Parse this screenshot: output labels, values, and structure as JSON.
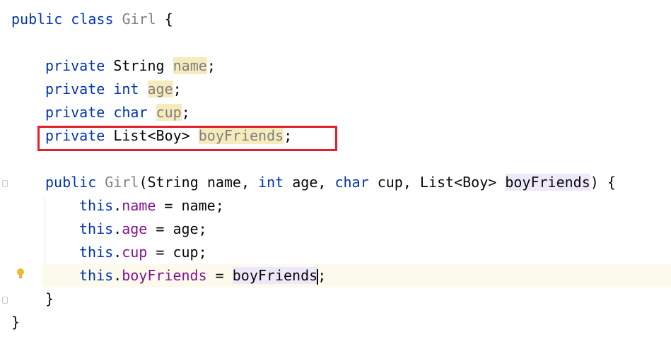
{
  "editor": {
    "lines": [
      {
        "id": "l1",
        "text": "public class Girl {"
      },
      {
        "id": "l3",
        "text": "private String name;"
      },
      {
        "id": "l4",
        "text": "private int age;"
      },
      {
        "id": "l5",
        "text": "private char cup;"
      },
      {
        "id": "l6",
        "text": "private List<Boy> boyFriends;"
      },
      {
        "id": "l8",
        "text": "public Girl(String name, int age, char cup, List<Boy> boyFriends) {"
      },
      {
        "id": "l9",
        "text": "this.name = name;"
      },
      {
        "id": "l10",
        "text": "this.age = age;"
      },
      {
        "id": "l11",
        "text": "this.cup = cup;"
      },
      {
        "id": "l12",
        "text": "this.boyFriends = boyFriends;"
      },
      {
        "id": "l13",
        "text": "}"
      },
      {
        "id": "l14",
        "text": "}"
      }
    ],
    "tokens": {
      "public": "public",
      "class": "class",
      "girl": "Girl",
      "open_brace": "{",
      "close_brace": "}",
      "private": "private",
      "string_type": "String",
      "int_type": "int",
      "char_type": "char",
      "list_boy": "List<Boy>",
      "name": "name",
      "age": "age",
      "cup": "cup",
      "boyFriends": "boyFriends",
      "semicolon": ";",
      "this": "this",
      "dot": ".",
      "assign": " = "
    },
    "highlight_colors": {
      "keyword": "#0033b3",
      "field": "#871094",
      "unused_field_bg": "#f6ebbc",
      "selection_bg": "#ede9fb",
      "annotation_box": "#e5202a",
      "current_line_bg": "#fcfaed"
    },
    "icons": {
      "gutter_bulb": "lightbulb-icon",
      "fold_marker": "fold-marker-icon"
    }
  }
}
